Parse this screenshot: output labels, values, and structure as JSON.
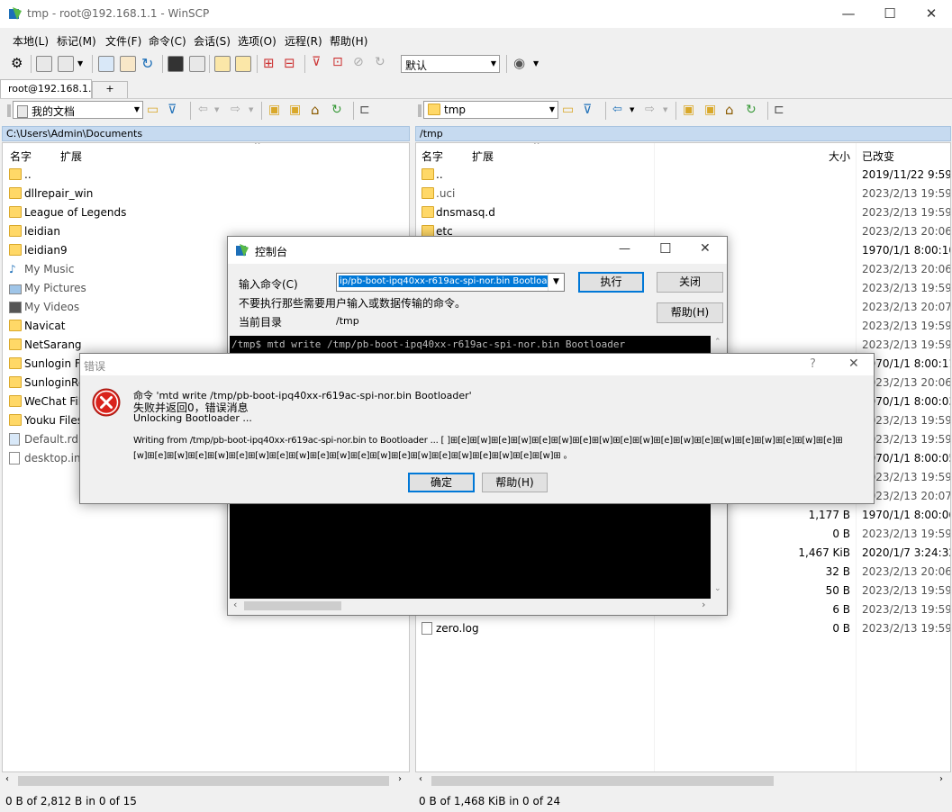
{
  "window": {
    "title": "tmp - root@192.168.1.1 - WinSCP",
    "minimize": "—",
    "maximize": "☐",
    "close": "✕"
  },
  "menu": [
    "本地(L)",
    "标记(M)",
    "文件(F)",
    "命令(C)",
    "会话(S)",
    "选项(O)",
    "远程(R)",
    "帮助(H)"
  ],
  "toolbar": {
    "transfer_settings": "默认"
  },
  "tabs": {
    "session": "root@192.168.1.1",
    "new": "+"
  },
  "left_panel": {
    "location": "我的文档",
    "path": "C:\\Users\\Admin\\Documents",
    "columns": {
      "name": "名字",
      "ext": "扩展"
    },
    "files": [
      {
        "name": "..",
        "type": "up"
      },
      {
        "name": "dllrepair_win",
        "type": "folder"
      },
      {
        "name": "League of Legends",
        "type": "folder"
      },
      {
        "name": "leidian",
        "type": "folder"
      },
      {
        "name": "leidian9",
        "type": "folder"
      },
      {
        "name": "My Music",
        "type": "music"
      },
      {
        "name": "My Pictures",
        "type": "pictures"
      },
      {
        "name": "My Videos",
        "type": "videos"
      },
      {
        "name": "Navicat",
        "type": "folder"
      },
      {
        "name": "NetSarang",
        "type": "folder"
      },
      {
        "name": "Sunlogin Fi",
        "type": "folder"
      },
      {
        "name": "SunloginRe",
        "type": "folder"
      },
      {
        "name": "WeChat File",
        "type": "folder"
      },
      {
        "name": "Youku Files",
        "type": "folder"
      },
      {
        "name": "Default.rdp",
        "type": "rdp"
      },
      {
        "name": "desktop.ini",
        "type": "ini"
      }
    ],
    "status": "0 B of 2,812 B in 0 of 15"
  },
  "right_panel": {
    "location": "tmp",
    "path": "/tmp",
    "columns": {
      "name": "名字",
      "ext": "扩展",
      "size": "大小",
      "changed": "已改变"
    },
    "files": [
      {
        "name": "..",
        "size": "",
        "changed": "2019/11/22 9:59:",
        "type": "up"
      },
      {
        "name": ".uci",
        "size": "",
        "changed": "2023/2/13 19:59:",
        "type": "folder"
      },
      {
        "name": "dnsmasq.d",
        "size": "",
        "changed": "2023/2/13 19:59:",
        "type": "folder"
      },
      {
        "name": "etc",
        "size": "",
        "changed": "2023/2/13 20:06:",
        "type": "folder"
      },
      {
        "name": "",
        "size": "",
        "changed": "1970/1/1 8:00:10",
        "type": ""
      },
      {
        "name": "",
        "size": "",
        "changed": "2023/2/13 20:06:",
        "type": ""
      },
      {
        "name": "",
        "size": "",
        "changed": "2023/2/13 19:59:",
        "type": ""
      },
      {
        "name": "",
        "size": "",
        "changed": "2023/2/13 20:07:",
        "type": ""
      },
      {
        "name": "",
        "size": "",
        "changed": "2023/2/13 19:59:",
        "type": ""
      },
      {
        "name": "",
        "size": "",
        "changed": "2023/2/13 19:59:",
        "type": ""
      },
      {
        "name": "",
        "size": "",
        "changed": "1970/1/1 8:00:11",
        "type": ""
      },
      {
        "name": "",
        "size": "",
        "changed": "2023/2/13 20:06:",
        "type": ""
      },
      {
        "name": "",
        "size": "",
        "changed": "1970/1/1 8:00:03",
        "type": ""
      },
      {
        "name": "",
        "size": "",
        "changed": "2023/2/13 19:59:",
        "type": ""
      },
      {
        "name": "",
        "size": "",
        "changed": "2023/2/13 19:59:",
        "type": ""
      },
      {
        "name": "",
        "size": "",
        "changed": "1970/1/1 8:00:05",
        "type": ""
      },
      {
        "name": "",
        "size": "",
        "changed": "2023/2/13 19:59:",
        "type": ""
      },
      {
        "name": "",
        "size": "",
        "changed": "2023/2/13 20:07:",
        "type": ""
      },
      {
        "name": "",
        "size": "1,177 B",
        "changed": "1970/1/1 8:00:06",
        "type": ""
      },
      {
        "name": "",
        "size": "0 B",
        "changed": "2023/2/13 19:59:",
        "type": ""
      },
      {
        "name": "",
        "size": "1,467 KiB",
        "changed": "2020/1/7 3:24:32",
        "type": ""
      },
      {
        "name": "",
        "size": "32 B",
        "changed": "2023/2/13 20:06:",
        "type": ""
      },
      {
        "name": "",
        "size": "50 B",
        "changed": "2023/2/13 19:59:",
        "type": ""
      },
      {
        "name": "",
        "size": "6 B",
        "changed": "2023/2/13 19:59:",
        "type": ""
      },
      {
        "name": "zero.log",
        "size": "0 B",
        "changed": "2023/2/13 19:59:",
        "type": "file"
      }
    ],
    "status": "0 B of 1,468 KiB in 0 of 24"
  },
  "console": {
    "title": "控制台",
    "command_label": "输入命令(C)",
    "command_value": "ip/pb-boot-ipq40xx-r619ac-spi-nor.bin Bootloader",
    "warning": "不要执行那些需要用户输入或数据传输的命令。",
    "current_dir_label": "当前目录",
    "current_dir": "/tmp",
    "execute": "执行",
    "close": "关闭",
    "help": "帮助(H)",
    "output": "/tmp$ mtd write /tmp/pb-boot-ipq40xx-r619ac-spi-nor.bin Bootloader"
  },
  "error": {
    "title": "错误",
    "help_q": "?",
    "close": "✕",
    "line1": "命令 'mtd write /tmp/pb-boot-ipq40xx-r619ac-spi-nor.bin Bootloader'",
    "line2": "失败并返回0，错误消息",
    "line3": "Unlocking Bootloader ...",
    "line4": "Writing from /tmp/pb-boot-ipq40xx-r619ac-spi-nor.bin to Bootloader ...  [ ]⊞[e]⊞[w]⊞[e]⊞[w]⊞[e]⊞[w]⊞[e]⊞[w]⊞[e]⊞[w]⊞[e]⊞[w]⊞[e]⊞[w]⊞[e]⊞[w]⊞[e]⊞[w]⊞[e]⊞",
    "line5": "[w]⊞[e]⊞[w]⊞[e]⊞[w]⊞[e]⊞[w]⊞[e]⊞[w]⊞[e]⊞[w]⊞[e]⊞[w]⊞[e]⊞[w]⊞[e]⊞[w]⊞[e]⊞[w]⊞[e]⊞[w]⊞    。",
    "ok": "确定",
    "help": "帮助(H)"
  }
}
